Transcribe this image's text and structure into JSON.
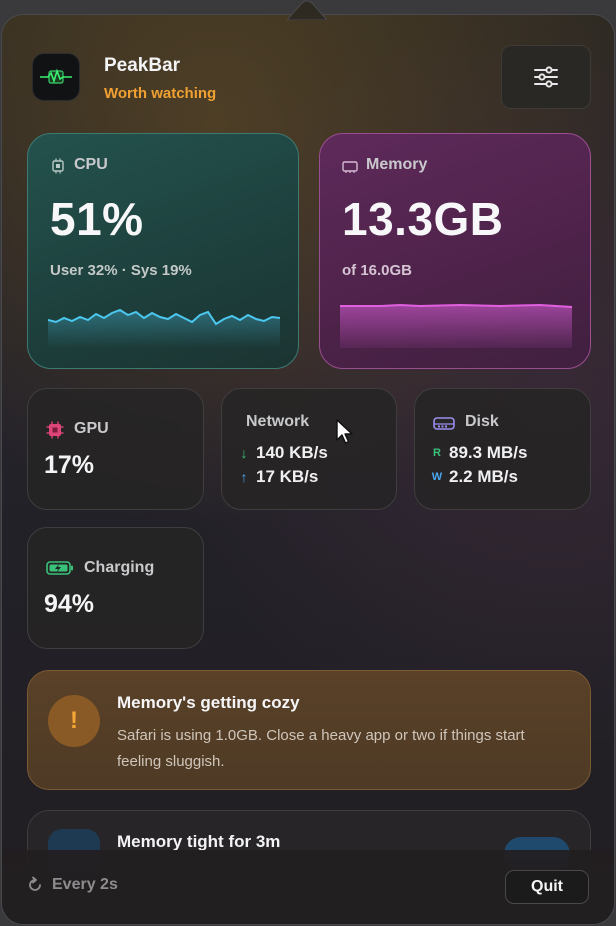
{
  "app": {
    "name": "PeakBar",
    "status": "Worth watching"
  },
  "colors": {
    "status": "#f0a132",
    "cpu_line": "#4cc8f0",
    "mem_line": "#e060e0",
    "net_down": "#3ac27a",
    "net_up": "#4aa8f0",
    "disk_read": "#3ac27a",
    "disk_write": "#4aa8f0"
  },
  "cpu": {
    "label": "CPU",
    "value": "51%",
    "detail": "User 32% · Sys 19%"
  },
  "memory": {
    "label": "Memory",
    "value": "13.3GB",
    "detail": "of 16.0GB"
  },
  "gpu": {
    "label": "GPU",
    "value": "17%"
  },
  "network": {
    "label": "Network",
    "down": "140 KB/s",
    "up": "17 KB/s",
    "down_icon": "↓",
    "up_icon": "↑"
  },
  "disk": {
    "label": "Disk",
    "read": "89.3 MB/s",
    "write": "2.2 MB/s",
    "read_tag": "R",
    "write_tag": "W"
  },
  "battery": {
    "label": "Charging",
    "value": "94%"
  },
  "alert": {
    "icon": "!",
    "title": "Memory's getting cozy",
    "body": "Safari is using 1.0GB. Close a heavy app or two if things start feeling sluggish."
  },
  "tip": {
    "title": "Memory tight for 3m"
  },
  "footer": {
    "refresh_label": "Every 2s",
    "quit_label": "Quit"
  }
}
